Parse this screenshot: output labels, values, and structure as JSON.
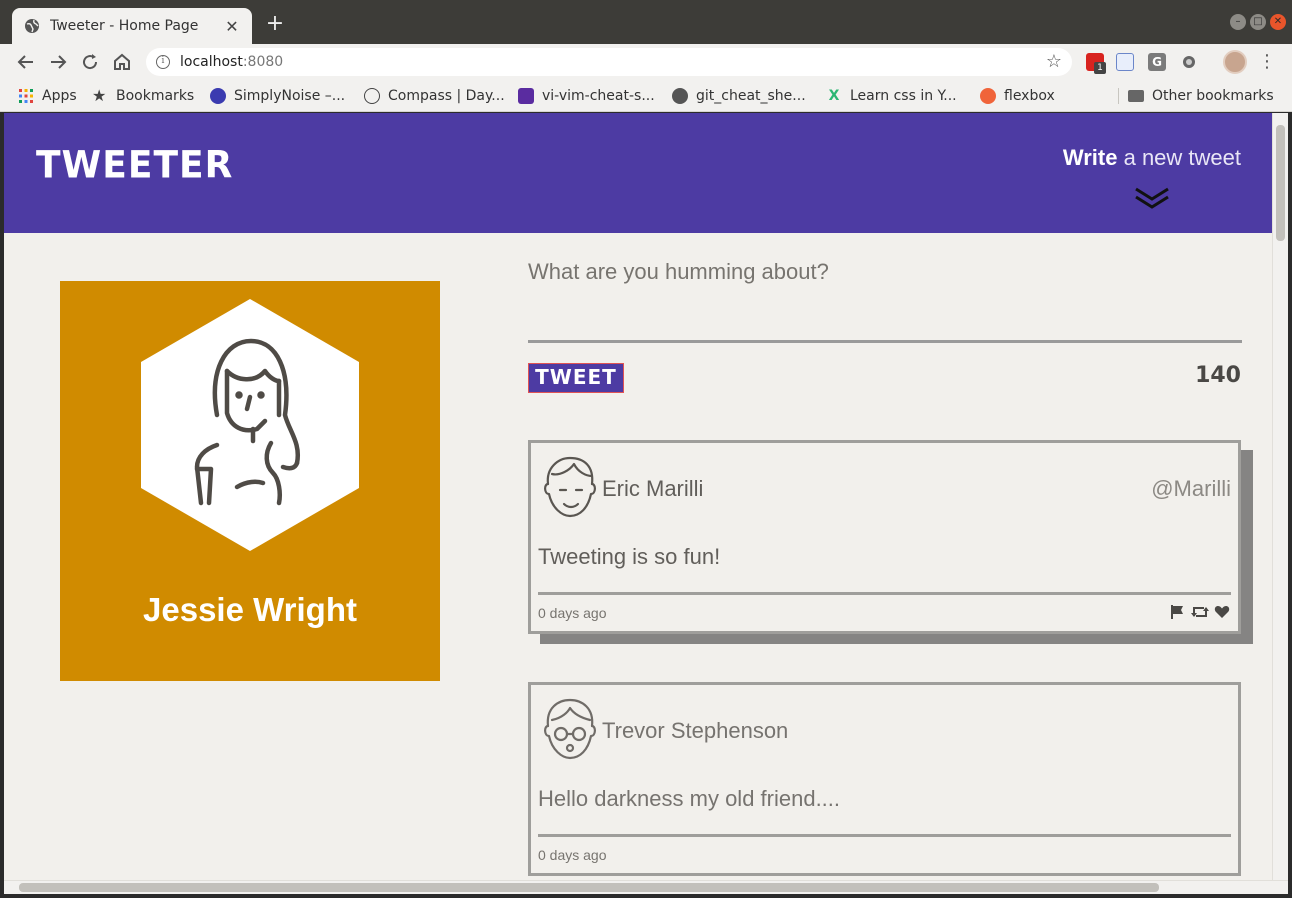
{
  "browser": {
    "tab_title": "Tweeter - Home Page",
    "url_host": "localhost",
    "url_port": ":8080",
    "bookmarks": [
      {
        "label": "Apps",
        "icon": "apps-grid-icon"
      },
      {
        "label": "Bookmarks",
        "icon": "star-icon"
      },
      {
        "label": "SimplyNoise –...",
        "icon": "simplynoise-icon"
      },
      {
        "label": "Compass | Day...",
        "icon": "compass-icon"
      },
      {
        "label": "vi-vim-cheat-s...",
        "icon": "vim-icon"
      },
      {
        "label": "git_cheat_she...",
        "icon": "globe-icon"
      },
      {
        "label": "Learn css in Y...",
        "icon": "learnxiny-icon"
      },
      {
        "label": "flexbox",
        "icon": "flexbox-icon"
      }
    ],
    "other_bookmarks": "Other bookmarks",
    "extension_badge": "1"
  },
  "header": {
    "logo": "TWEETER",
    "write_bold": "Write",
    "write_rest": " a new tweet"
  },
  "profile": {
    "name": "Jessie Wright",
    "card_color": "#d08b00"
  },
  "composer": {
    "placeholder": "What are you humming about?",
    "button_label": "TWEET",
    "counter": "140"
  },
  "tweets": [
    {
      "name": "Eric Marilli",
      "handle": "@Marilli",
      "text": "Tweeting is so fun!",
      "time": "0 days ago"
    },
    {
      "name": "Trevor Stephenson",
      "handle": "",
      "text": "Hello darkness my old friend....",
      "time": "0 days ago"
    }
  ],
  "colors": {
    "header": "#4d3ba3",
    "page_bg": "#f2f0ec",
    "accent_border": "#e05355"
  }
}
